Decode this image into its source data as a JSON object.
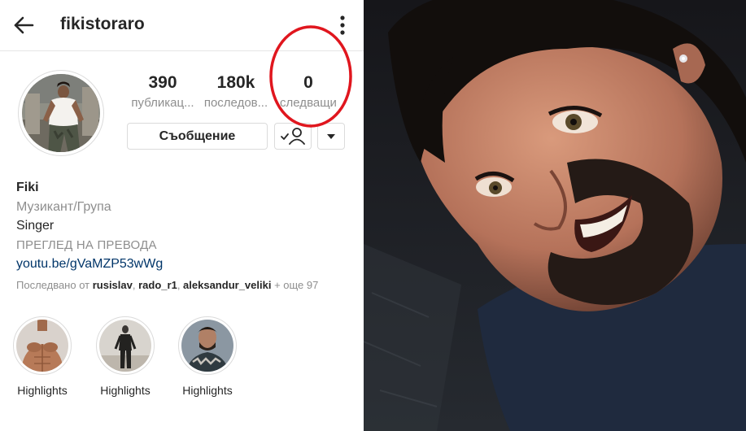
{
  "profile": {
    "username": "fikistoraro",
    "stats": [
      {
        "value": "390",
        "label": "публикац..."
      },
      {
        "value": "180k",
        "label": "последов..."
      },
      {
        "value": "0",
        "label": "следващи"
      }
    ],
    "message_button": "Съобщение",
    "bio": {
      "name": "Fiki",
      "category": "Музикант/Група",
      "text": "Singer",
      "translate": "ПРЕГЛЕД НА ПРЕВОДА",
      "link": "youtu.be/gVaMZP53wWg"
    },
    "followed_by": {
      "prefix": "Последвано от ",
      "accounts": [
        "rusislav",
        "rado_r1",
        "aleksandur_veliki"
      ],
      "separator": ", ",
      "suffix": " + още 97"
    },
    "highlights": [
      {
        "label": "Highlights"
      },
      {
        "label": "Highlights"
      },
      {
        "label": "Highlights"
      }
    ]
  },
  "annotation": {
    "circle_color": "#e0161e"
  },
  "colors": {
    "text_primary": "#262626",
    "text_secondary": "#8e8e8e",
    "link": "#003569",
    "border": "#dbdbdb"
  },
  "icons": {
    "back": "back-arrow-icon",
    "menu": "kebab-menu-icon",
    "following": "following-check-icon",
    "dropdown": "caret-down-icon"
  }
}
